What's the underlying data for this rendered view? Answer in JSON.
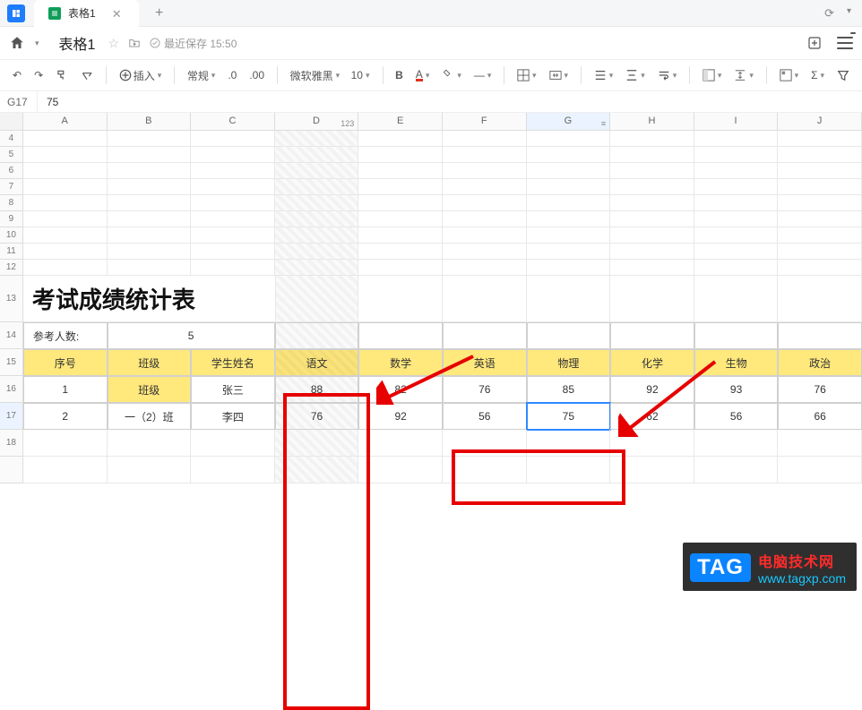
{
  "tabs": {
    "logo": "logo",
    "file": "表格1",
    "add": "+"
  },
  "titlebar": {
    "home": "⌂",
    "title": "表格1",
    "save": "最近保存 15:50"
  },
  "toolbar": {
    "insert": "插入",
    "format_number": "常规",
    "decimals": ".0",
    "decimals2": ".00",
    "font": "微软雅黑",
    "fontsize": "10",
    "bold": "B",
    "fontcolor": "A",
    "hline": "―",
    "sigma": "Σ",
    "filter": "⧩"
  },
  "formula": {
    "ref": "G17",
    "val": "75"
  },
  "columns": [
    "A",
    "B",
    "C",
    "D",
    "E",
    "F",
    "G",
    "H",
    "I",
    "J"
  ],
  "col_marker": "123",
  "filter_icon": "≡",
  "rows_top": [
    "4",
    "5",
    "6",
    "7",
    "8",
    "9",
    "10",
    "11",
    "12"
  ],
  "title_row": "13",
  "title_text": "考试成绩统计表",
  "count_row": {
    "num": "14",
    "label": "参考人数:",
    "value": "5"
  },
  "header_row_num": "15",
  "headers": [
    "序号",
    "班级",
    "学生姓名",
    "语文",
    "数学",
    "英语",
    "物理",
    "化学",
    "生物",
    "政治"
  ],
  "data_rows": [
    {
      "num": "16",
      "cells": [
        "1",
        "班级",
        "张三",
        "88",
        "82",
        "76",
        "85",
        "92",
        "93",
        "76"
      ],
      "hl": [
        1
      ]
    },
    {
      "num": "17",
      "cells": [
        "2",
        "一（2）班",
        "李四",
        "76",
        "92",
        "56",
        "75",
        "62",
        "56",
        "66"
      ],
      "hl": []
    }
  ],
  "empty_row_num": "18",
  "watermark": {
    "badge": "TAG",
    "cn": "电脑技术网",
    "url": "www.tagxp.com"
  }
}
